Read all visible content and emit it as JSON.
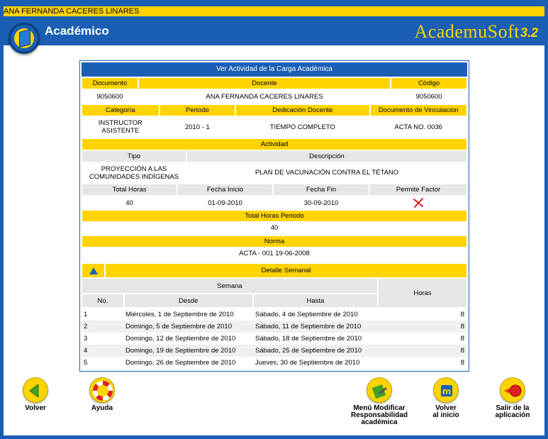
{
  "user_bar": {
    "name": "ANA FERNANDA CACERES LINARES"
  },
  "header": {
    "title": "Académico",
    "brand": "AcademuSoft",
    "version": "3.2"
  },
  "card": {
    "title": "Ver Actividad de la Carga Académica",
    "docente_headers": {
      "documento": "Documento",
      "docente": "Docente",
      "codigo": "Código"
    },
    "docente_values": {
      "documento": "9050600",
      "docente": "ANA FERNANDA CACERES LINARES",
      "codigo": "9050600"
    },
    "cat_headers": {
      "categoria": "Categoría",
      "periodo": "Periodo",
      "dedicacion": "Dedicación Docente",
      "vinculacion": "Documento de Vinculación"
    },
    "cat_values": {
      "categoria_l1": "INSTRUCTOR",
      "categoria_l2": "ASISTENTE",
      "periodo": "2010 - 1",
      "dedicacion": "TIEMPO COMPLETO",
      "vinculacion": "ACTA NO. 0036"
    },
    "actividad_label": "Actividad",
    "act_headers": {
      "tipo": "Tipo",
      "descripcion": "Descripción"
    },
    "act_values": {
      "tipo_l1": "PROYECCIÓN A LAS",
      "tipo_l2": "COMUNIDADES INDÍGENAS",
      "descripcion": "PLAN DE VACUNACIÓN CONTRA EL TÉTANO"
    },
    "horas_headers": {
      "total": "Total Horas",
      "inicio": "Fecha Inicio",
      "fin": "Fecha Fin",
      "factor": "Permite Factor"
    },
    "horas_values": {
      "total": "40",
      "inicio": "01-09-2010",
      "fin": "30-09-2010"
    },
    "total_periodo_label": "Total Horas Periodo",
    "total_periodo_value": "40",
    "norma_label": "Norma",
    "norma_value": "ACTA - 001 19-06-2008",
    "detalle_label": "Detalle Semanal",
    "semana_label": "Semana",
    "horas_label": "Horas",
    "no_label": "No.",
    "desde_label": "Desde",
    "hasta_label": "Hasta",
    "weeks": [
      {
        "no": "1",
        "desde": "Miércoles, 1 de Septiembre de 2010",
        "hasta": "Sábado, 4 de Septiembre de 2010",
        "horas": "8"
      },
      {
        "no": "2",
        "desde": "Domingo, 5 de Septiembre de 2010",
        "hasta": "Sábado, 11 de Septiembre de 2010",
        "horas": "8"
      },
      {
        "no": "3",
        "desde": "Domingo, 12 de Septiembre de 2010",
        "hasta": "Sábado, 18 de Septiembre de 2010",
        "horas": "8"
      },
      {
        "no": "4",
        "desde": "Domingo, 19 de Septiembre de 2010",
        "hasta": "Sábado, 25 de Septiembre de 2010",
        "horas": "8"
      },
      {
        "no": "5",
        "desde": "Domingo, 26 de Septiembre de 2010",
        "hasta": "Jueves, 30 de Septiembre de 2010",
        "horas": "8"
      }
    ]
  },
  "nav": {
    "volver": "Volver",
    "ayuda": "Ayuda",
    "menu_l1": "Menú Modificar",
    "menu_l2": "Responsabilidad",
    "menu_l3": "académica",
    "inicio_l1": "Volver",
    "inicio_l2": "al inicio",
    "salir_l1": "Salir de la",
    "salir_l2": "aplicación"
  },
  "colors": {
    "primary": "#1a5fb4",
    "accent": "#ffd400",
    "gray": "#e6e6e6",
    "danger": "#e02020"
  },
  "icons": [
    "logo-icon",
    "collapse-up-icon",
    "cross-icon",
    "back-arrow-icon",
    "lifebuoy-icon",
    "edit-menu-icon",
    "home-icon",
    "exit-icon"
  ]
}
